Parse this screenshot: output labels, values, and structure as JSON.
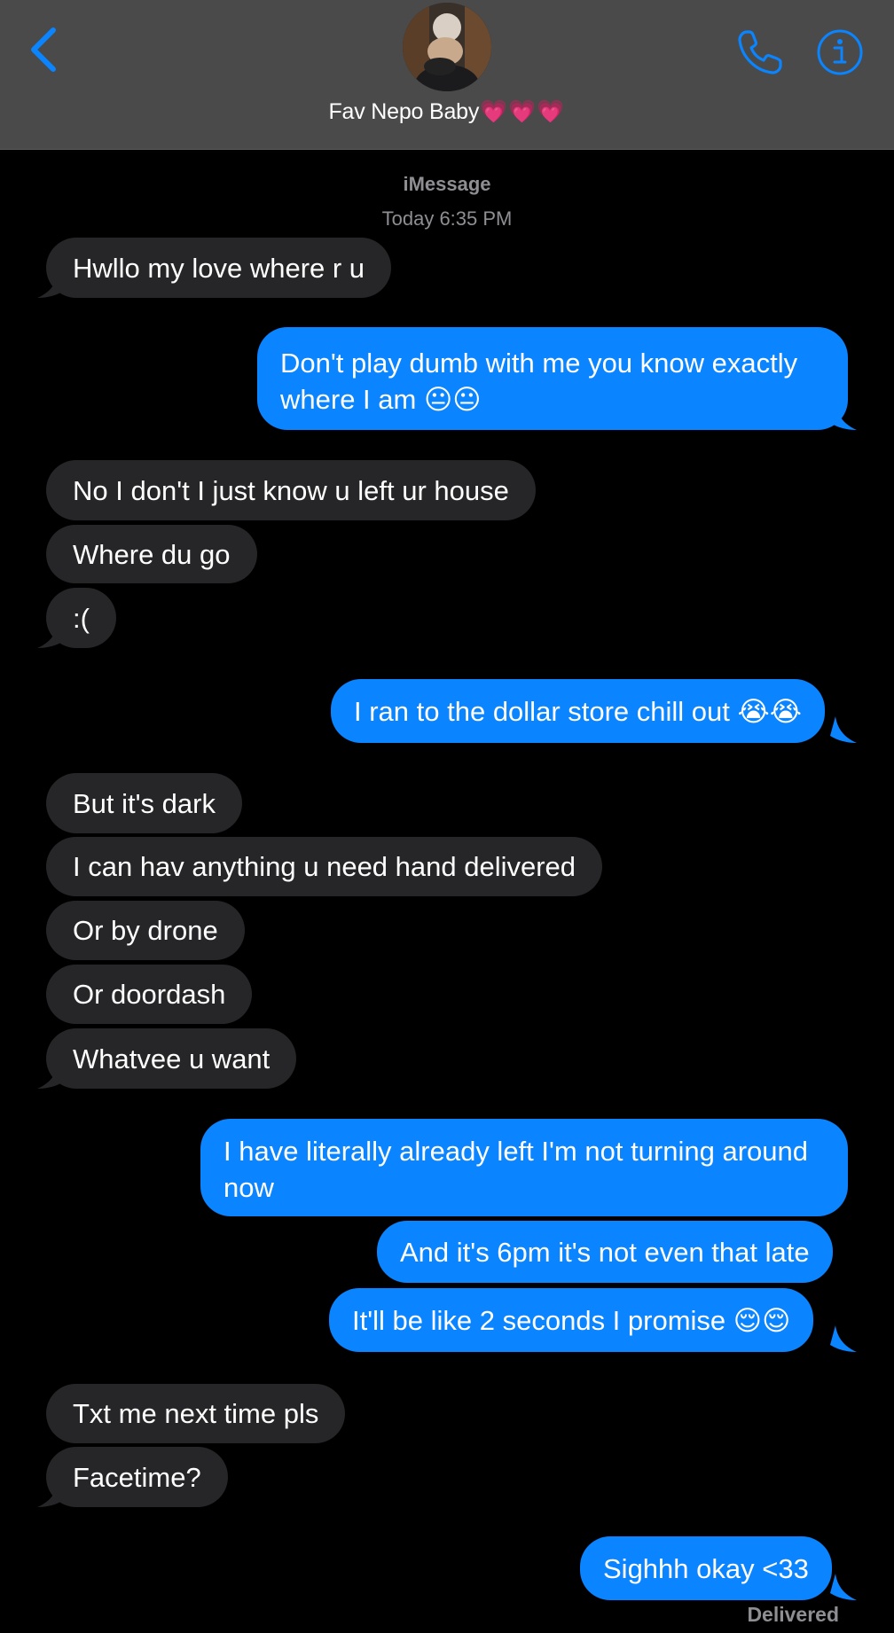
{
  "header": {
    "contact_name": "Fav Nepo Baby",
    "contact_hearts": "💗💗💗",
    "back_icon": "chevron-left-icon",
    "call_icon": "phone-icon",
    "info_icon": "info-icon",
    "accent_color": "#0a84ff"
  },
  "thread": {
    "service": "iMessage",
    "timestamp": "Today 6:35 PM",
    "delivered_status": "Delivered"
  },
  "messages": [
    {
      "direction": "incoming",
      "text": "Hwllo my love where r u"
    },
    {
      "direction": "outgoing",
      "text": "Don't play dumb with me you know exactly where I am 😐😐"
    },
    {
      "direction": "incoming",
      "text": "No I don't I just know u left ur house"
    },
    {
      "direction": "incoming",
      "text": "Where du go"
    },
    {
      "direction": "incoming",
      "text": ":("
    },
    {
      "direction": "outgoing",
      "text": "I ran to the dollar store chill out 😭😭"
    },
    {
      "direction": "incoming",
      "text": "But it's dark"
    },
    {
      "direction": "incoming",
      "text": "I can hav anything u need hand delivered"
    },
    {
      "direction": "incoming",
      "text": "Or by drone"
    },
    {
      "direction": "incoming",
      "text": "Or doordash"
    },
    {
      "direction": "incoming",
      "text": "Whatvee u want"
    },
    {
      "direction": "outgoing",
      "text": "I have literally already left I'm not turning around now"
    },
    {
      "direction": "outgoing",
      "text": "And it's 6pm it's not even that late"
    },
    {
      "direction": "outgoing",
      "text": "It'll be like 2 seconds I promise 😌😌"
    },
    {
      "direction": "incoming",
      "text": "Txt me next time pls"
    },
    {
      "direction": "incoming",
      "text": "Facetime?"
    },
    {
      "direction": "outgoing",
      "text": "Sighhh okay <33"
    }
  ],
  "colors": {
    "incoming_bubble": "#262628",
    "outgoing_bubble": "#0a84ff",
    "header_bg": "#4a4a4a",
    "meta_text": "#8e8e93"
  }
}
